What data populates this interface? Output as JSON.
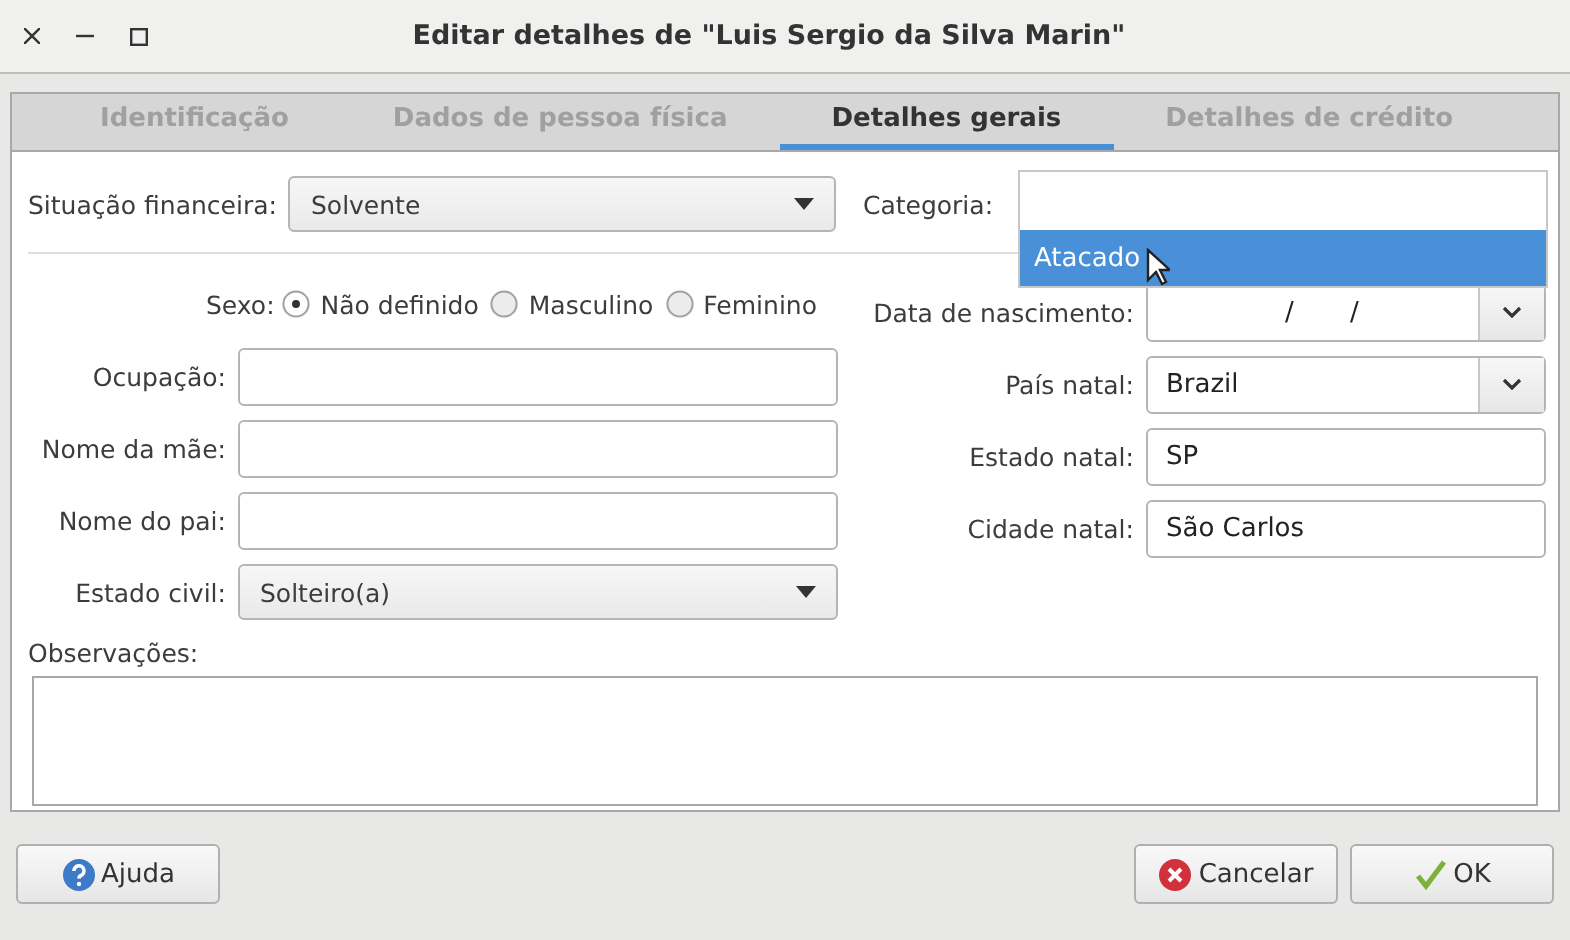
{
  "window": {
    "title": "Editar detalhes de \"Luis Sergio da Silva Marin\""
  },
  "tabs": [
    {
      "label": "Identificação",
      "selected": false
    },
    {
      "label": "Dados de pessoa física",
      "selected": false
    },
    {
      "label": "Detalhes gerais",
      "selected": true
    },
    {
      "label": "Detalhes de crédito",
      "selected": false
    }
  ],
  "financial": {
    "label": "Situação financeira:",
    "value": "Solvente"
  },
  "category": {
    "label": "Categoria:",
    "popup": [
      {
        "label": "Atacado",
        "selected": true
      }
    ]
  },
  "sex": {
    "label": "Sexo:",
    "options": [
      {
        "label": "Não definido",
        "selected": true
      },
      {
        "label": "Masculino",
        "selected": false
      },
      {
        "label": "Feminino",
        "selected": false
      }
    ]
  },
  "left_fields": [
    {
      "kind": "text",
      "label": "Ocupação:"
    },
    {
      "kind": "text",
      "label": "Nome da mãe:"
    },
    {
      "kind": "text",
      "label": "Nome do pai:"
    },
    {
      "kind": "select",
      "label": "Estado civil:",
      "value": "Solteiro(a)"
    }
  ],
  "right_fields": [
    {
      "kind": "date",
      "label": "Data de nascimento:",
      "value": "/ /"
    },
    {
      "kind": "combo",
      "label": "País natal:",
      "value": "Brazil"
    },
    {
      "kind": "text",
      "label": "Estado natal:",
      "value": "SP"
    },
    {
      "kind": "text",
      "label": "Cidade natal:",
      "value": "São Carlos"
    }
  ],
  "observations": {
    "label": "Observações:"
  },
  "buttons": [
    {
      "kind": "help",
      "label": "Ajuda"
    },
    {
      "kind": "cancel",
      "label": "Cancelar"
    },
    {
      "kind": "ok",
      "label": "OK"
    }
  ]
}
